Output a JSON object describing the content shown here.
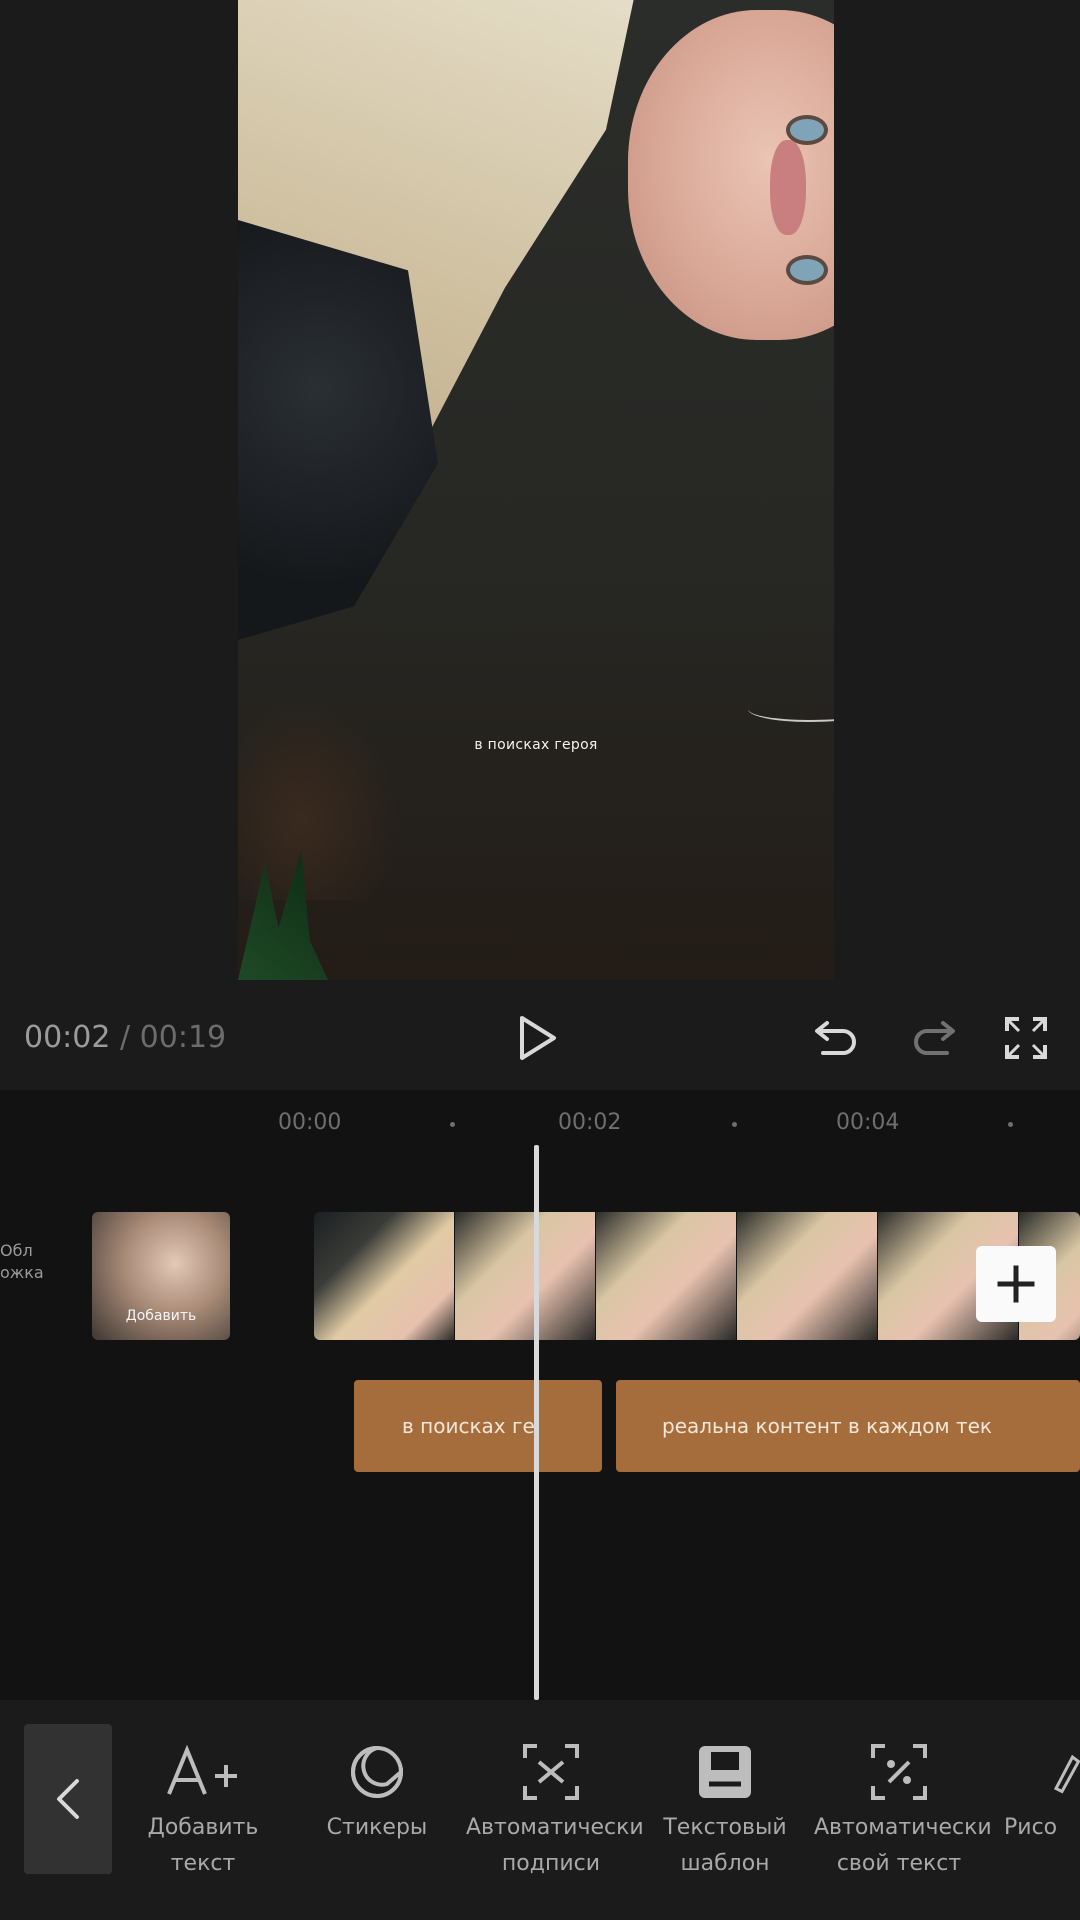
{
  "player": {
    "current_time": "00:02",
    "separator": "/",
    "total_time": "00:19",
    "subtitle": "в поисках героя"
  },
  "timeline": {
    "ticks": [
      "00:00",
      "00:02",
      "00:04"
    ],
    "cover_label_line1": "Обл",
    "cover_label_line2": "ожка",
    "cover_thumb_label": "Добавить",
    "text_clips": [
      "в поисках ге",
      "реальна контент в каждом тек"
    ]
  },
  "toolbar": {
    "tools": [
      {
        "label": "Добавить текст",
        "icon": "add-text-icon"
      },
      {
        "label": "Стикеры",
        "icon": "sticker-icon"
      },
      {
        "label": "Автоматически подписи",
        "icon": "auto-captions-icon"
      },
      {
        "label": "Текстовый шаблон",
        "icon": "text-template-icon"
      },
      {
        "label": "Автоматически свой текст",
        "icon": "auto-lyrics-icon"
      },
      {
        "label": "Рисо",
        "icon": "draw-icon"
      }
    ]
  },
  "colors": {
    "background": "#1b1b1b",
    "timeline_bg": "#121212",
    "text_clip": "#a66d3c",
    "playhead": "#d9d9d9"
  }
}
